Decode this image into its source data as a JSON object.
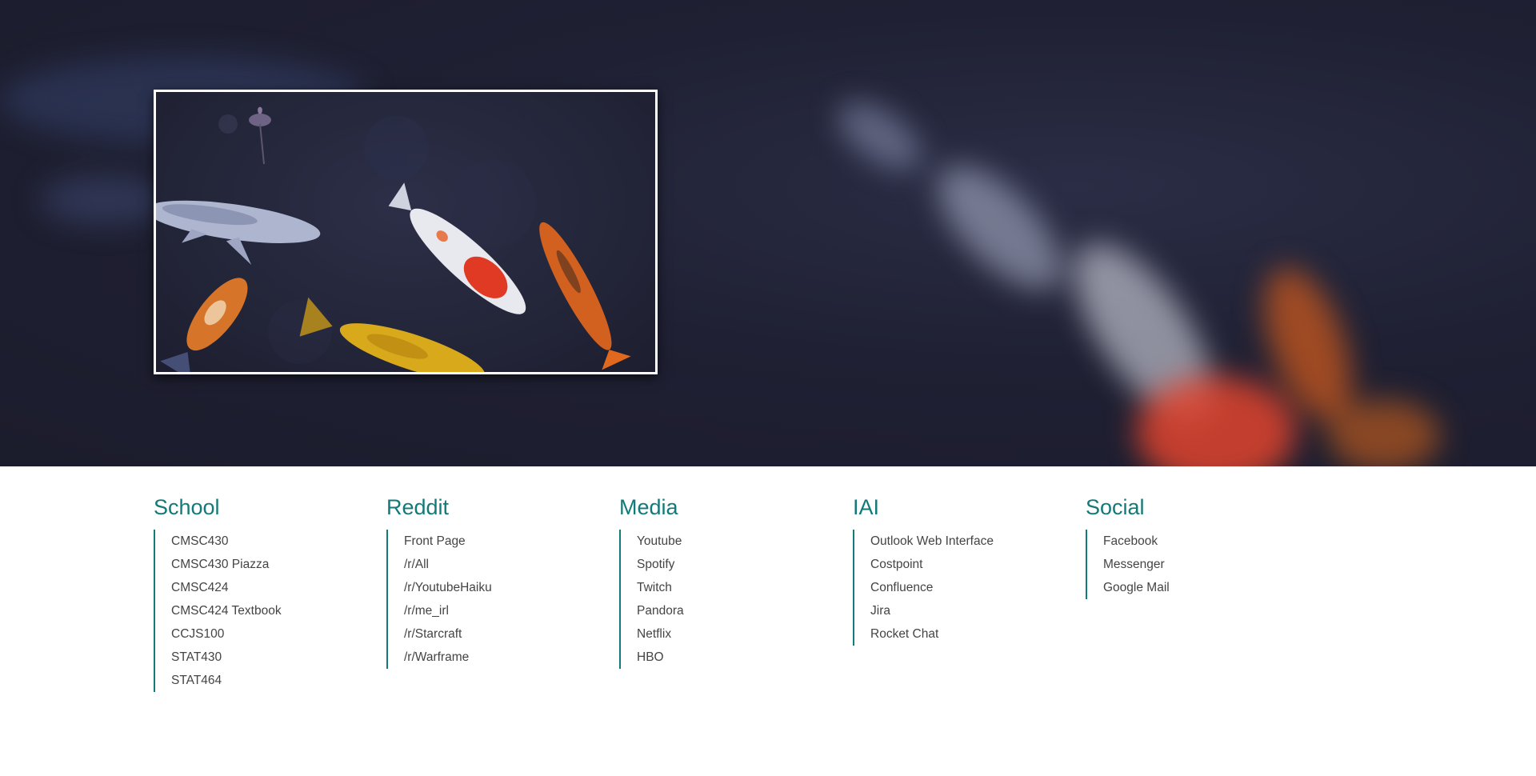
{
  "hero": {
    "image": "koi-pond-image"
  },
  "groups": [
    {
      "title": "School",
      "links": [
        "CMSC430",
        "CMSC430 Piazza",
        "CMSC424",
        "CMSC424 Textbook",
        "CCJS100",
        "STAT430",
        "STAT464"
      ]
    },
    {
      "title": "Reddit",
      "links": [
        "Front Page",
        "/r/All",
        "/r/YoutubeHaiku",
        "/r/me_irl",
        "/r/Starcraft",
        "/r/Warframe"
      ]
    },
    {
      "title": "Media",
      "links": [
        "Youtube",
        "Spotify",
        "Twitch",
        "Pandora",
        "Netflix",
        "HBO"
      ]
    },
    {
      "title": "IAI",
      "links": [
        "Outlook Web Interface",
        "Costpoint",
        "Confluence",
        "Jira",
        "Rocket Chat"
      ]
    },
    {
      "title": "Social",
      "links": [
        "Facebook",
        "Messenger",
        "Google Mail"
      ]
    }
  ],
  "colors": {
    "accent": "#127a78",
    "link_text": "#444444",
    "hero_bg": "#1f2033"
  }
}
